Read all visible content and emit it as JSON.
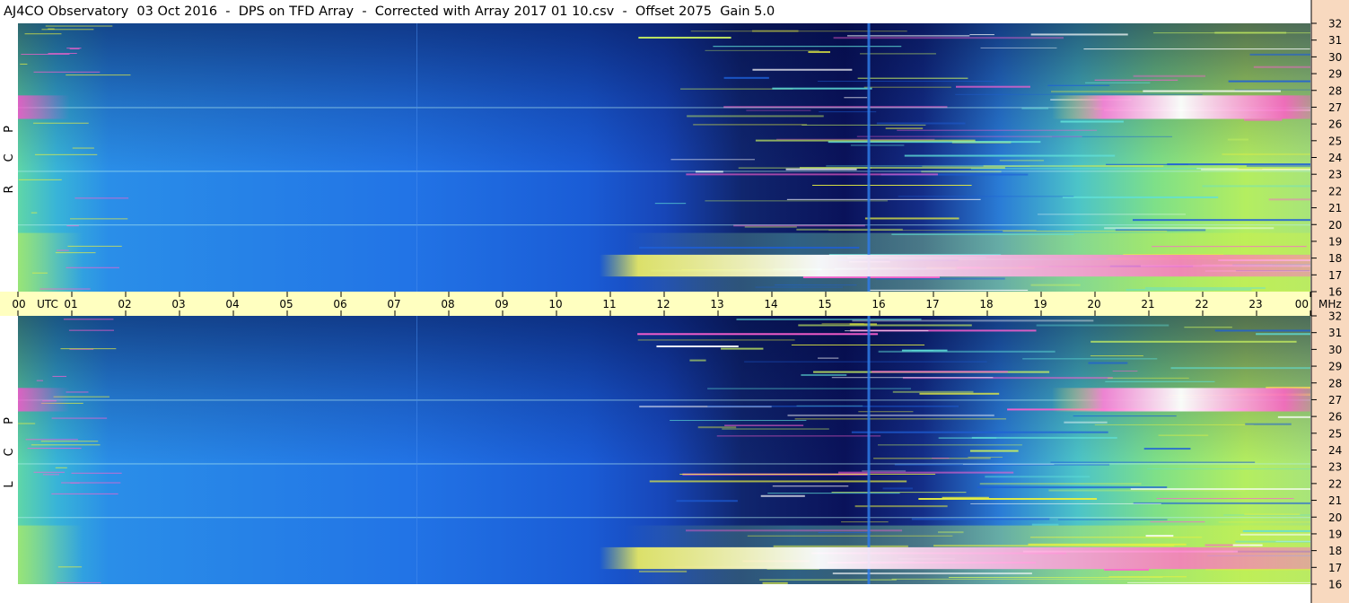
{
  "chart_data": {
    "type": "heatmap",
    "title": "AJ4CO Observatory  03 Oct 2016  -  DPS on TFD Array  -  Corrected with Array 2017 01 10.csv  -  Offset 2075  Gain 5.0",
    "x_axis": {
      "labels": [
        "00",
        "01",
        "02",
        "03",
        "04",
        "05",
        "06",
        "07",
        "08",
        "09",
        "10",
        "11",
        "12",
        "13",
        "14",
        "15",
        "16",
        "17",
        "18",
        "19",
        "20",
        "21",
        "22",
        "23",
        "00"
      ],
      "unit_label": "UTC",
      "range_hours": [
        0,
        24
      ]
    },
    "y_axis": {
      "labels": [
        16,
        17,
        18,
        19,
        20,
        21,
        22,
        23,
        24,
        25,
        26,
        27,
        28,
        29,
        30,
        31,
        32
      ],
      "unit_label": "MHz",
      "range_mhz": [
        16,
        32
      ]
    },
    "panels": [
      {
        "name": "RCP",
        "side_letters": [
          "R",
          "C",
          "P"
        ]
      },
      {
        "name": "LCP",
        "side_letters": [
          "L",
          "C",
          "P"
        ]
      }
    ],
    "colors": {
      "axis_band": "#ffffc0",
      "right_strip": "#f8d9bf",
      "low_intensity": "#0a1260",
      "mid_intensity": "#1f68e6",
      "high_intensity": "#b9f15a",
      "saturated": "#ffffff"
    },
    "colormap": "blue-cyan-yellow-magenta-white",
    "grid": false
  }
}
